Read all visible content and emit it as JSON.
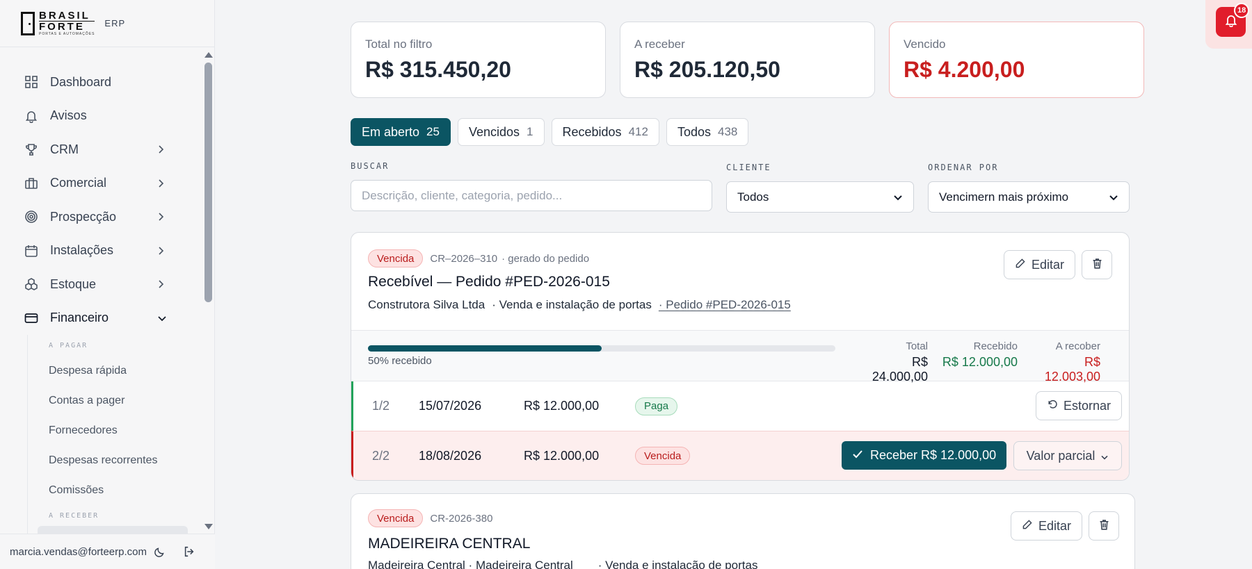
{
  "brand": {
    "line1": "BRASIL",
    "line2": "FORTE",
    "tagline": "PORTAS E AUTOMAÇÕES",
    "suffix": "ERP"
  },
  "nav": {
    "items": [
      {
        "label": "Dashboard",
        "icon": "grid-icon"
      },
      {
        "label": "Avisos",
        "icon": "bell-icon"
      },
      {
        "label": "CRM",
        "icon": "trophy-icon"
      },
      {
        "label": "Comercial",
        "icon": "briefcase-icon"
      },
      {
        "label": "Prospecção",
        "icon": "target-icon"
      },
      {
        "label": "Instalações",
        "icon": "calendar-icon"
      },
      {
        "label": "Estoque",
        "icon": "boxes-icon"
      },
      {
        "label": "Financeiro",
        "icon": "credit-card-icon"
      }
    ],
    "pagar_header": "A PAGAR",
    "pagar_items": [
      "Despesa rápida",
      "Contas a pager",
      "Fornecedores",
      "Despesas recorrentes",
      "Comissões"
    ],
    "receber_header": "A RECEBER"
  },
  "user": {
    "email": "marcia.vendas@forteerp.com"
  },
  "notifications": {
    "count": "18"
  },
  "kpis": [
    {
      "label": "Total no filtro",
      "value": "R$ 315.450,20"
    },
    {
      "label": "A receber",
      "value": "R$ 205.120,50"
    },
    {
      "label": "Vencido",
      "value": "R$ 4.200,00"
    }
  ],
  "tabs": [
    {
      "label": "Em aberto",
      "count": "25"
    },
    {
      "label": "Vencidos",
      "count": "1"
    },
    {
      "label": "Recebidos",
      "count": "412"
    },
    {
      "label": "Todos",
      "count": "438"
    }
  ],
  "filters": {
    "search_label": "BUSCAR",
    "search_placeholder": "Descrição, cliente, categoria, pedido...",
    "cliente_label": "CLIENTE",
    "cliente_value": "Todos",
    "ordenar_label": "ORDENAR POR",
    "ordenar_value": "Vencimern mais próximo"
  },
  "card1": {
    "status": "Vencida",
    "code": "CR–2026–310",
    "origin": "· gerado do pedido",
    "title": "Recebível — Pedido #PED-2026-015",
    "client": "Construtora Silva Ltda",
    "category": "· Venda e instalação de portas",
    "order_link": "· Pedido #PED-2026-015",
    "edit_label": "Editar",
    "progress": 0.5,
    "progress_label": "50% recebido",
    "total_label": "Total",
    "total_value": "R$ 24.000,00",
    "received_label": "Recebido",
    "received_value": "R$ 12.000,00",
    "pending_label": "A recober",
    "pending_value": "R$ 12.003,00",
    "installments": [
      {
        "num": "1/2",
        "date": "15/07/2026",
        "value": "R$ 12.000,00",
        "status": "Paga",
        "action": "Estornar"
      },
      {
        "num": "2/2",
        "date": "18/08/2026",
        "value": "R$ 12.000,00",
        "status": "Vencida",
        "action": "Receber R$ 12.000,00",
        "secondary": "Valor parcial"
      }
    ]
  },
  "card2": {
    "status": "Vencida",
    "code": "CR-2026-380",
    "title": "MADEIREIRA CENTRAL",
    "client": "Madeireira Central · Madeireira Central",
    "category": "· Venda e instalação de portas",
    "edit_label": "Editar"
  }
}
